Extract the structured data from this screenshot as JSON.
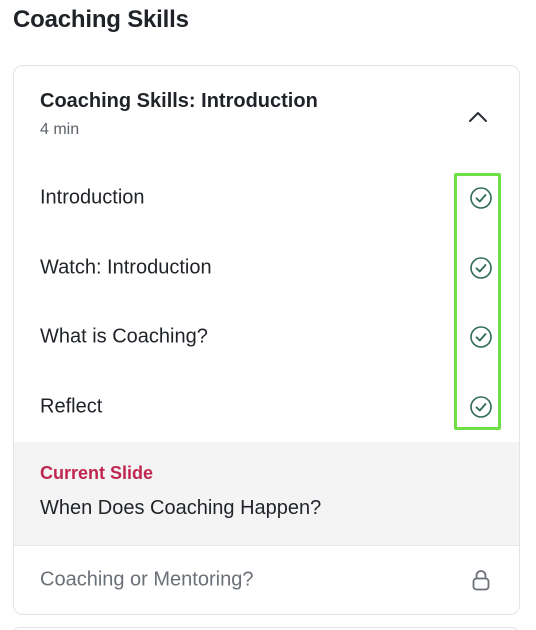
{
  "section": {
    "title": "Coaching Skills"
  },
  "module": {
    "title": "Coaching Skills: Introduction",
    "duration": "4 min",
    "expanded": true,
    "toggle_icon": "chevron-up-icon"
  },
  "lessons": [
    {
      "label": "Introduction",
      "status": "completed",
      "icon": "check-circle-icon"
    },
    {
      "label": "Watch: Introduction",
      "status": "completed",
      "icon": "check-circle-icon"
    },
    {
      "label": "What is Coaching?",
      "status": "completed",
      "icon": "check-circle-icon"
    },
    {
      "label": "Reflect",
      "status": "completed",
      "icon": "check-circle-icon"
    }
  ],
  "current": {
    "label": "Current Slide",
    "title": "When Does Coaching Happen?"
  },
  "locked": [
    {
      "label": "Coaching or Mentoring?",
      "status": "locked",
      "icon": "lock-icon"
    }
  ],
  "colors": {
    "check": "#2f6b57",
    "current_label": "#c0264f",
    "current_bg": "#f4f4f5",
    "highlight": "#6ee045",
    "lock": "#6b7078"
  }
}
